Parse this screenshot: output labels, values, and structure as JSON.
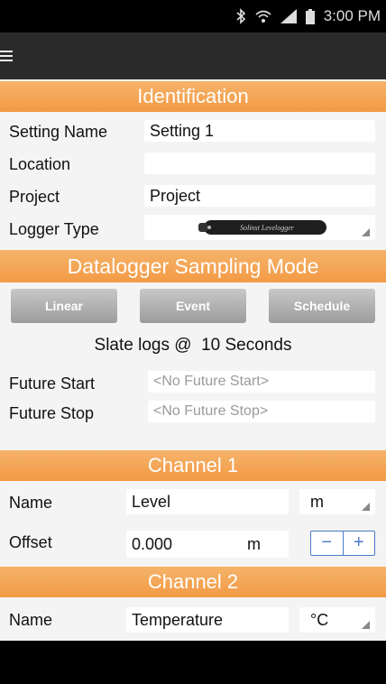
{
  "status": {
    "time": "3:00 PM"
  },
  "sections": {
    "identification": "Identification",
    "sampling_mode": "Datalogger Sampling Mode",
    "channel1": "Channel 1",
    "channel2": "Channel 2"
  },
  "identification": {
    "setting_name_label": "Setting Name",
    "setting_name_value": "Setting 1",
    "location_label": "Location",
    "location_value": "",
    "project_label": "Project",
    "project_value": "Project",
    "logger_type_label": "Logger Type",
    "logger_brand": "Solinst Levelogger"
  },
  "sampling": {
    "buttons": [
      "Linear",
      "Event",
      "Schedule"
    ],
    "summary": "Slate logs @  10 Seconds",
    "future_start_label": "Future Start",
    "future_start_placeholder": "<No Future Start>",
    "future_stop_label": "Future Stop",
    "future_stop_placeholder": "<No Future Stop>"
  },
  "channel1": {
    "name_label": "Name",
    "name_value": "Level",
    "unit": "m",
    "offset_label": "Offset",
    "offset_value": "0.000",
    "offset_unit": "m",
    "minus": "−",
    "plus": "+"
  },
  "channel2": {
    "name_label": "Name",
    "name_value": "Temperature",
    "unit": "°C"
  },
  "colors": {
    "section_header": "#f39a45",
    "stepper_accent": "#4a7bc8"
  }
}
